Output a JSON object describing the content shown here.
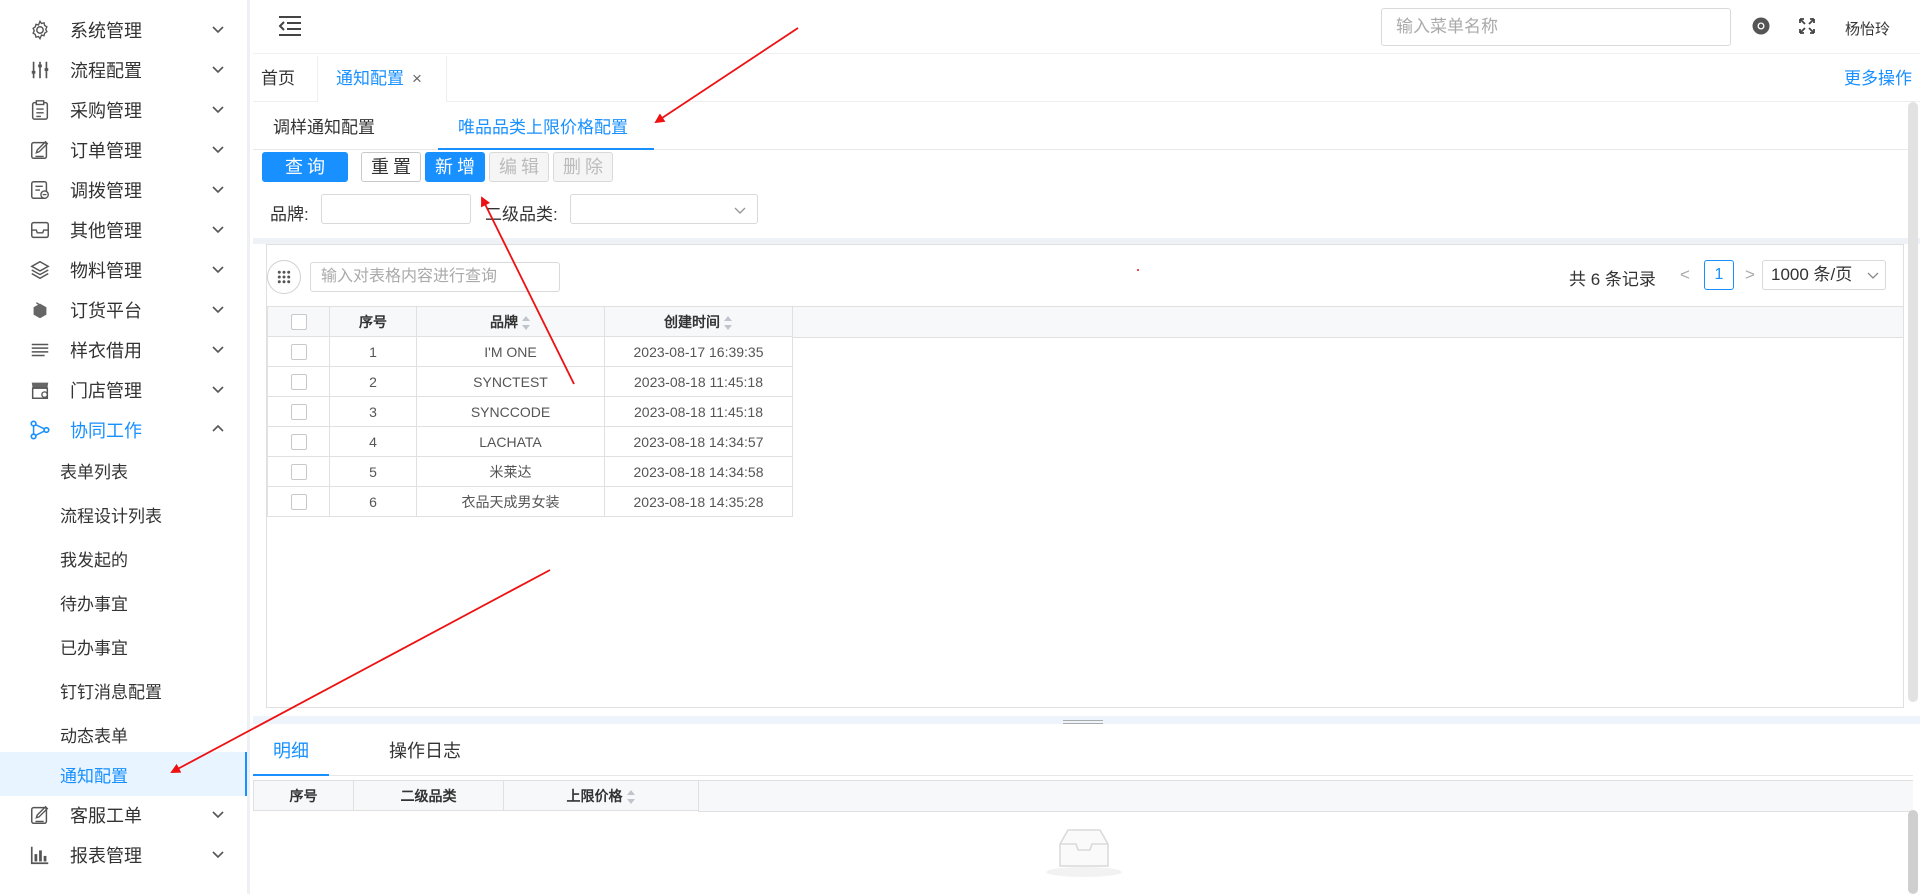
{
  "sidebar": {
    "menus": [
      {
        "label": "系统管理",
        "icon": "gear-icon"
      },
      {
        "label": "流程配置",
        "icon": "sliders-icon"
      },
      {
        "label": "采购管理",
        "icon": "clipboard-icon"
      },
      {
        "label": "订单管理",
        "icon": "edit-icon"
      },
      {
        "label": "调拨管理",
        "icon": "transfer-icon"
      },
      {
        "label": "其他管理",
        "icon": "inbox-icon"
      },
      {
        "label": "物料管理",
        "icon": "layers-icon"
      },
      {
        "label": "订货平台",
        "icon": "box-icon"
      },
      {
        "label": "样衣借用",
        "icon": "stack-icon"
      },
      {
        "label": "门店管理",
        "icon": "store-icon"
      },
      {
        "label": "协同工作",
        "icon": "share-icon"
      }
    ],
    "submenu": [
      "表单列表",
      "流程设计列表",
      "我发起的",
      "待办事宜",
      "已办事宜",
      "钉钉消息配置",
      "动态表单",
      "通知配置"
    ],
    "after_menus": [
      {
        "label": "客服工单",
        "icon": "edit-icon"
      },
      {
        "label": "报表管理",
        "icon": "bar-chart-icon"
      }
    ]
  },
  "header": {
    "menu_search_placeholder": "输入菜单名称",
    "username": "杨怡玲"
  },
  "tabs": {
    "home": "首页",
    "active": "通知配置",
    "close": "×",
    "more": "更多操作"
  },
  "subtabs": [
    "调样通知配置",
    "唯品品类上限价格配置"
  ],
  "toolbar": {
    "query": "查询",
    "reset": "重置",
    "add": "新增",
    "edit": "编辑",
    "delete": "删除"
  },
  "filters": {
    "brand_label": "品牌:",
    "category_label": "二级品类:"
  },
  "table": {
    "search_placeholder": "输入对表格内容进行查询",
    "total": "共 6 条记录",
    "page": "1",
    "page_size": "1000 条/页",
    "columns": [
      "序号",
      "品牌",
      "创建时间"
    ],
    "rows": [
      [
        "1",
        "I'M ONE",
        "2023-08-17 16:39:35"
      ],
      [
        "2",
        "SYNCTEST",
        "2023-08-18 11:45:18"
      ],
      [
        "3",
        "SYNCCODE",
        "2023-08-18 11:45:18"
      ],
      [
        "4",
        "LACHATA",
        "2023-08-18 14:34:57"
      ],
      [
        "5",
        "米莱达",
        "2023-08-18 14:34:58"
      ],
      [
        "6",
        "衣品天成男女装",
        "2023-08-18 14:35:28"
      ]
    ]
  },
  "detail": {
    "tabs": [
      "明细",
      "操作日志"
    ],
    "columns": [
      "序号",
      "二级品类",
      "上限价格"
    ]
  },
  "colors": {
    "accent": "#1890ff",
    "annotation_arrow": "#ee1111"
  }
}
